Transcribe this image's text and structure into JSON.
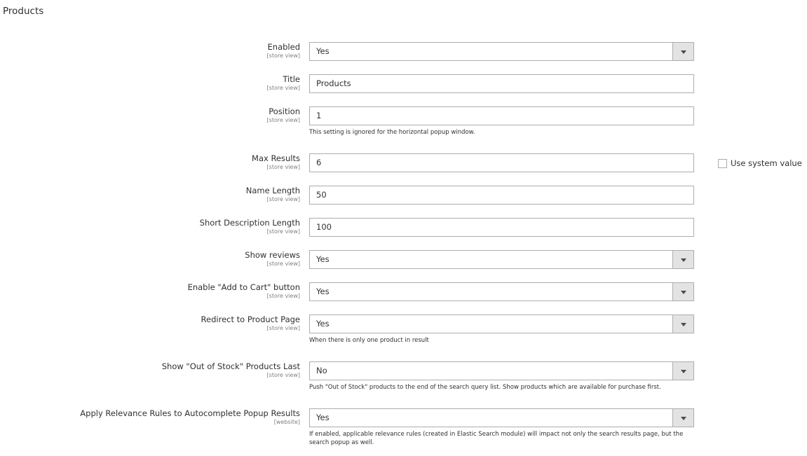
{
  "section_title": "Products",
  "fields": [
    {
      "label": "Enabled",
      "scope": "[store view]",
      "type": "select",
      "value": "Yes"
    },
    {
      "label": "Title",
      "scope": "[store view]",
      "type": "text",
      "value": "Products"
    },
    {
      "label": "Position",
      "scope": "[store view]",
      "type": "text",
      "value": "1",
      "note": "This setting is ignored for the horizontal popup window."
    },
    {
      "label": "Max Results",
      "scope": "[store view]",
      "type": "text",
      "value": "6",
      "system_value_label": "Use system value",
      "system_value_checked": false
    },
    {
      "label": "Name Length",
      "scope": "[store view]",
      "type": "text",
      "value": "50"
    },
    {
      "label": "Short Description Length",
      "scope": "[store view]",
      "type": "text",
      "value": "100"
    },
    {
      "label": "Show reviews",
      "scope": "[store view]",
      "type": "select",
      "value": "Yes"
    },
    {
      "label": "Enable \"Add to Cart\" button",
      "scope": "[store view]",
      "type": "select",
      "value": "Yes"
    },
    {
      "label": "Redirect to Product Page",
      "scope": "[store view]",
      "type": "select",
      "value": "Yes",
      "note": "When there is only one product in result"
    },
    {
      "label": "Show \"Out of Stock\" Products Last",
      "scope": "[store view]",
      "type": "select",
      "value": "No",
      "note": "Push \"Out of Stock\" products to the end of the search query list. Show products which are available for purchase first."
    },
    {
      "label": "Apply Relevance Rules to Autocomplete Popup Results",
      "scope": "[website]",
      "type": "select",
      "value": "Yes",
      "note": "If enabled, applicable relevance rules (created in Elastic Search module) will impact not only the search results page, but the search popup as well."
    }
  ]
}
